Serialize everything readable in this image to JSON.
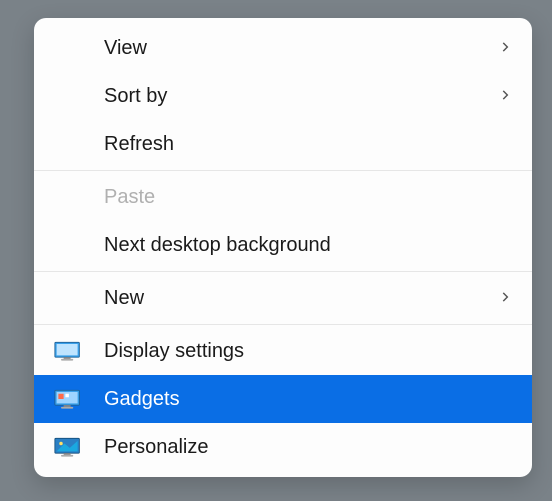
{
  "menu": {
    "items": [
      {
        "label": "View",
        "submenu": true
      },
      {
        "label": "Sort by",
        "submenu": true
      },
      {
        "label": "Refresh"
      },
      {
        "separator": true
      },
      {
        "label": "Paste",
        "disabled": true
      },
      {
        "label": "Next desktop background"
      },
      {
        "separator": true
      },
      {
        "label": "New",
        "submenu": true
      },
      {
        "separator": true
      },
      {
        "label": "Display settings",
        "icon": "monitor-icon"
      },
      {
        "label": "Gadgets",
        "icon": "gadgets-icon",
        "selected": true
      },
      {
        "label": "Personalize",
        "icon": "personalize-icon"
      }
    ]
  }
}
